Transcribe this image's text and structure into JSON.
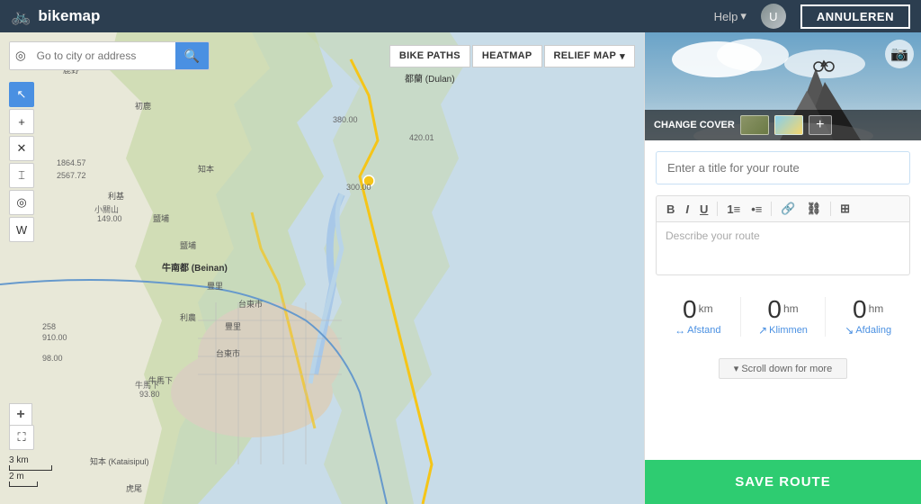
{
  "header": {
    "logo_icon": "🚲",
    "logo_text": "bikemap",
    "help_label": "Help",
    "help_chevron": "▾",
    "annuleren_label": "ANNULEREN",
    "avatar_initials": "U"
  },
  "map_toolbar": {
    "search_placeholder": "Go to city or address",
    "bike_paths_label": "BIKE PATHS",
    "heatmap_label": "HEATMAP",
    "relief_map_label": "RELIEF MAP",
    "relief_chevron": "▾"
  },
  "map_tools": {
    "tool1": "↖",
    "tool2": "+",
    "tool3": "✕",
    "tool4": "⌶",
    "tool5": "◎",
    "tool6": "W"
  },
  "map_zoom": {
    "plus": "+",
    "minus": "−"
  },
  "map_scale": {
    "line1": "3 km",
    "line2": "2 m"
  },
  "map_labels": {
    "beinan": "牛南都 (Beinan)",
    "dulan": "都蘭 (Dulan)",
    "elevation1": "380.00",
    "elevation2": "420.01",
    "elevation3": "300.00",
    "elevation4": "149.00",
    "elevation5": "1864.57",
    "elevation6": "2567.72",
    "elevation7": "910.00",
    "elevation8": "98.00"
  },
  "right_panel": {
    "camera_icon": "📷",
    "change_cover_label": "CHANGE COVER",
    "add_icon": "+",
    "title_placeholder": "Enter a title for your route",
    "describe_placeholder": "Describe your route",
    "rte_bold": "B",
    "rte_italic": "I",
    "rte_underline": "U",
    "rte_ol": "≡",
    "rte_ul": "≡",
    "rte_link": "🔗",
    "rte_unlink": "⛓",
    "rte_table": "⊞",
    "stats": [
      {
        "value": "0",
        "unit": "km",
        "label": "Afstand",
        "arrow": "↔"
      },
      {
        "value": "0",
        "unit": "hm",
        "label": "Klimmen",
        "arrow": "↗"
      },
      {
        "value": "0",
        "unit": "hm",
        "label": "Afdaling",
        "arrow": "↘"
      }
    ],
    "scroll_hint": "▾ Scroll down for more",
    "save_route_label": "SAVE ROUTE"
  }
}
